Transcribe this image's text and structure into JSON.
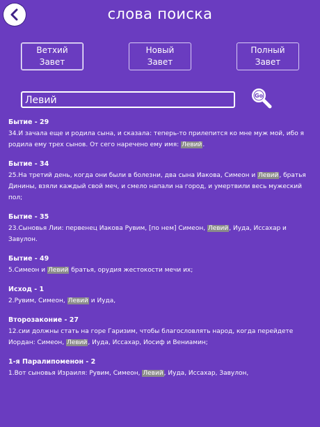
{
  "header": {
    "title": "слова поиска"
  },
  "testament": {
    "old": "Ветхий Завет",
    "new": "Новый Завет",
    "full": "Полный Завет"
  },
  "search": {
    "value": "Левий",
    "go_label": "Go"
  },
  "results": [
    {
      "ref": "Бытие - 29",
      "pre": "34.И зачала еще и родила сына, и сказала: теперь-то прилепится ко мне муж мой, ибо я родила ему трех сынов. От сего наречено ему имя: ",
      "hl": "Левий",
      "post": "."
    },
    {
      "ref": "Бытие - 34",
      "pre": "25.На третий день, когда они были в болезни, два сына Иакова, Симеон и ",
      "hl": "Левий",
      "post": ", братья Динины, взяли каждый свой меч, и смело напали на город, и умертвили весь мужеский пол;"
    },
    {
      "ref": "Бытие - 35",
      "pre": "23.Сыновья Лии: первенец Иакова Рувим, [по нем] Симеон, ",
      "hl": "Левий",
      "post": ", Иуда, Иссахар и Завулон."
    },
    {
      "ref": "Бытие - 49",
      "pre": "5.Симеон и ",
      "hl": "Левий",
      "post": " братья, орудия жестокости мечи их;"
    },
    {
      "ref": "Исход - 1",
      "pre": "2.Рувим, Симеон, ",
      "hl": "Левий",
      "post": " и Иуда,"
    },
    {
      "ref": "Второзаконие - 27",
      "pre": "12.сии должны стать на горе Гаризим, чтобы благословлять народ, когда перейдете Иордан: Симеон, ",
      "hl": "Левий",
      "post": ", Иуда, Иссахар, Иосиф и Вениамин;"
    },
    {
      "ref": "1-я Паралипоменон - 2",
      "pre": "1.Вот сыновья Израиля: Рувим, Симеон, ",
      "hl": "Левий",
      "post": ", Иуда, Иссахар, Завулон,"
    }
  ]
}
